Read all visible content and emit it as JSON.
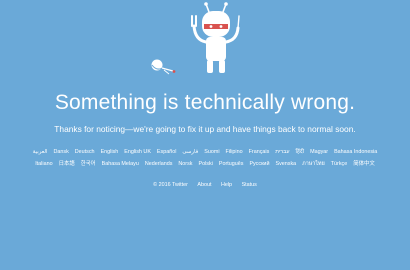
{
  "error": {
    "headline": "Something is technically wrong.",
    "message": "Thanks for noticing—we're going to fix it up and have things back to normal soon."
  },
  "languages": [
    "العربية",
    "Dansk",
    "Deutsch",
    "English",
    "English UK",
    "Español",
    "فارسی",
    "Suomi",
    "Filipino",
    "Français",
    "עברית",
    "हिंदी",
    "Magyar",
    "Bahasa Indonesia",
    "Italiano",
    "日本語",
    "한국어",
    "Bahasa Melayu",
    "Nederlands",
    "Norsk",
    "Polski",
    "Português",
    "Русский",
    "Svenska",
    "ภาษาไทย",
    "Türkçe",
    "简体中文"
  ],
  "footer": {
    "copyright": "© 2016 Twitter",
    "links": [
      "About",
      "Help",
      "Status"
    ]
  },
  "colors": {
    "background": "#6aa9d8",
    "text": "#ffffff",
    "robot_body": "#ffffff",
    "robot_visor": "#d9534f"
  }
}
